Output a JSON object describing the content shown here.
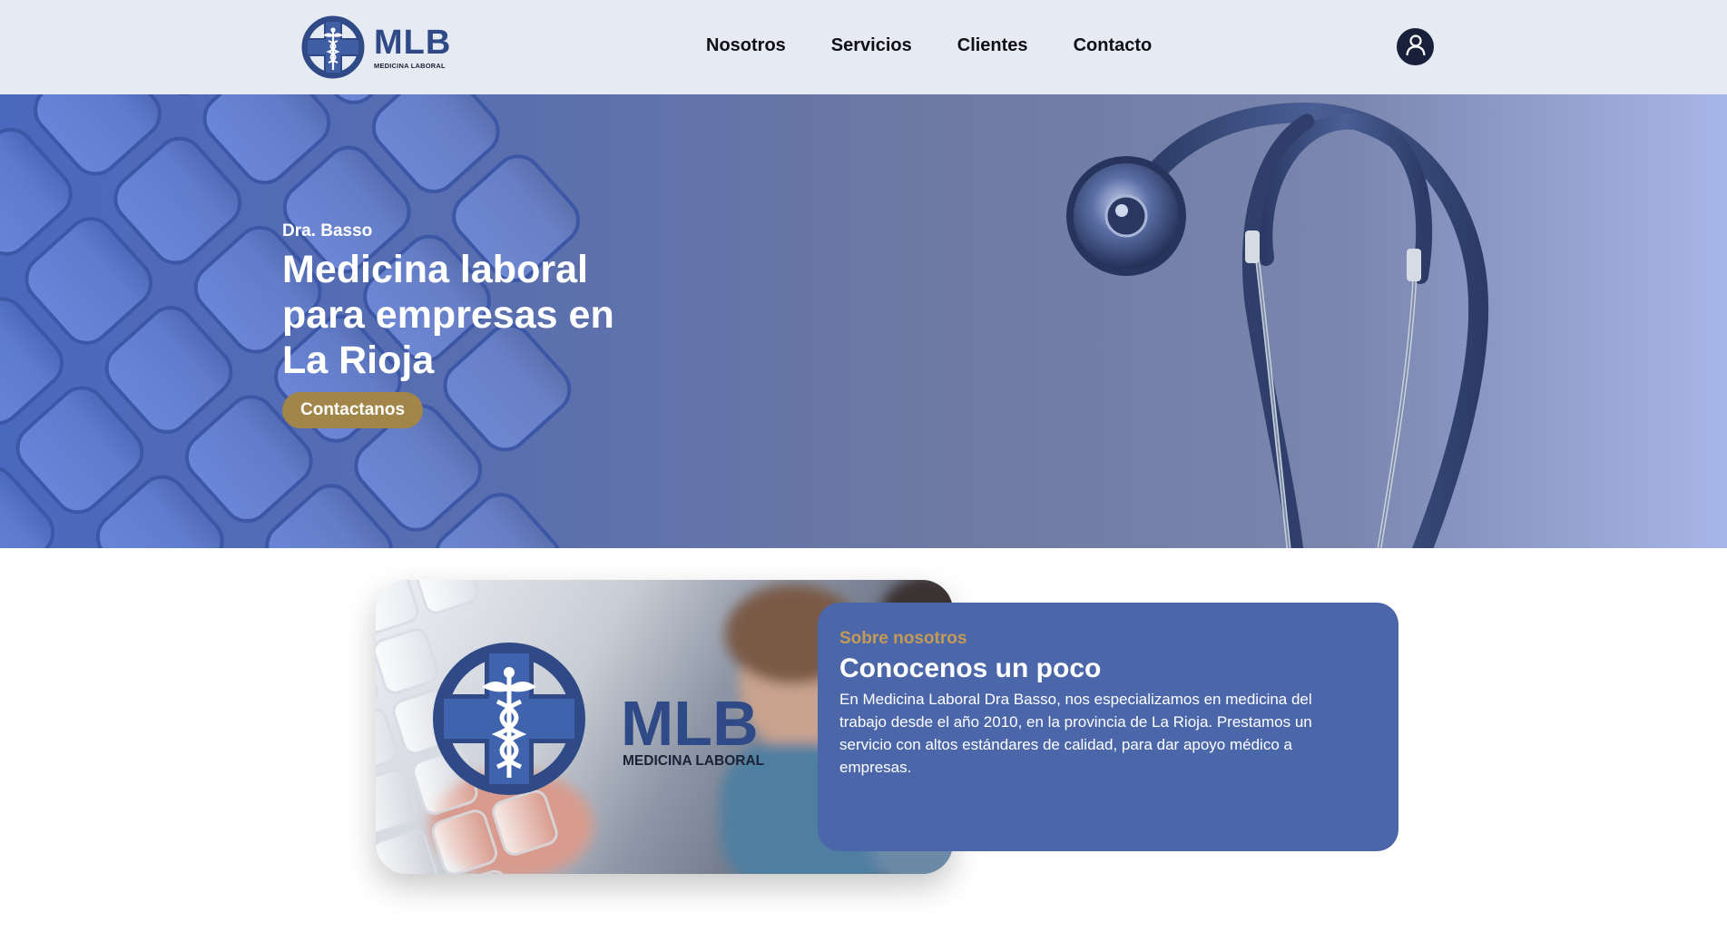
{
  "brand": {
    "title": "MLB",
    "subtitle": "MEDICINA LABORAL"
  },
  "nav": {
    "items": [
      "Nosotros",
      "Servicios",
      "Clientes",
      "Contacto"
    ]
  },
  "account": {
    "icon": "user-icon"
  },
  "hero": {
    "kicker": "Dra. Basso",
    "title": "Medicina laboral para empresas en La Rioja",
    "cta_label": "Contactanos"
  },
  "about": {
    "kicker": "Sobre nosotros",
    "title": "Conocenos un poco",
    "body": "En Medicina Laboral Dra Basso, nos especializamos en medicina del trabajo desde el año 2010, en la provincia de La Rioja. Prestamos un servicio con altos estándares de calidad, para dar apoyo médico a empresas.",
    "image_logo_title": "MLB",
    "image_logo_subtitle": "MEDICINA LABORAL"
  },
  "colors": {
    "header_bg": "#e6eaf2",
    "brand_blue": "#2f4a86",
    "cta_gold": "#a28548",
    "card_blue": "#4b67aa",
    "kicker_gold": "#c49a56",
    "account_navy": "#19213a"
  }
}
